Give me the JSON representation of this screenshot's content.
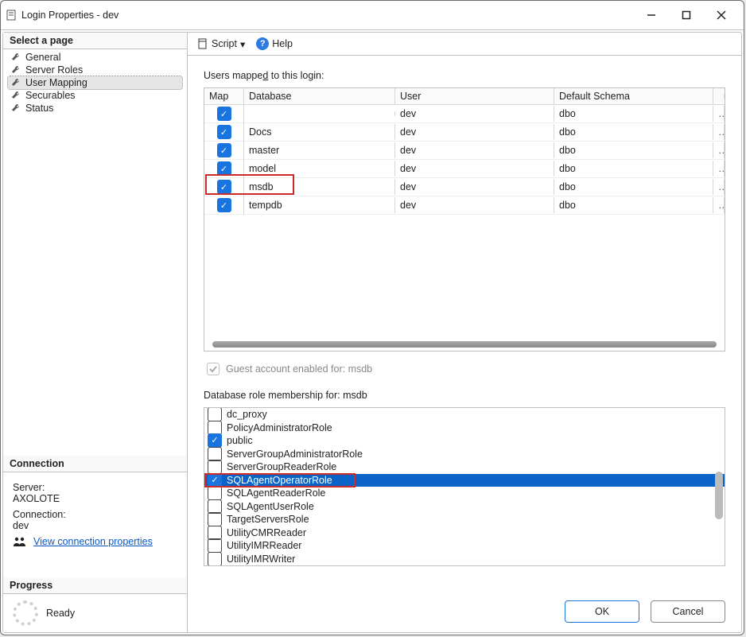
{
  "window": {
    "title": "Login Properties - dev"
  },
  "nav": {
    "heading": "Select a page",
    "items": [
      {
        "label": "General"
      },
      {
        "label": "Server Roles"
      },
      {
        "label": "User Mapping",
        "selected": true
      },
      {
        "label": "Securables"
      },
      {
        "label": "Status"
      }
    ]
  },
  "connection": {
    "heading": "Connection",
    "server_label": "Server:",
    "server_value": "AXOLOTE",
    "connection_label": "Connection:",
    "connection_value": "dev",
    "view_props_link": "View connection properties"
  },
  "progress": {
    "heading": "Progress",
    "status": "Ready"
  },
  "toolbar": {
    "script_label": "Script",
    "help_label": "Help"
  },
  "users_mapped": {
    "title_prefix": "Users mappe",
    "title_accel": "d",
    "title_suffix": " to this login:",
    "columns": {
      "map": "Map",
      "database": "Database",
      "user": "User",
      "schema": "Default Schema"
    },
    "rows": [
      {
        "checked": true,
        "database": "(redacted)",
        "redacted": true,
        "user": "dev",
        "schema": "dbo"
      },
      {
        "checked": true,
        "database": "Docs",
        "user": "dev",
        "schema": "dbo"
      },
      {
        "checked": true,
        "database": "master",
        "user": "dev",
        "schema": "dbo"
      },
      {
        "checked": true,
        "database": "model",
        "user": "dev",
        "schema": "dbo"
      },
      {
        "checked": true,
        "database": "msdb",
        "user": "dev",
        "schema": "dbo",
        "highlighted": true
      },
      {
        "checked": true,
        "database": "tempdb",
        "user": "dev",
        "schema": "dbo"
      }
    ]
  },
  "guest_row": {
    "label": "Guest account enabled for: msdb",
    "checked": true,
    "disabled": true
  },
  "roles": {
    "title": "Database role membership for: msdb",
    "items": [
      {
        "label": "dc_proxy",
        "checked": false
      },
      {
        "label": "PolicyAdministratorRole",
        "checked": false
      },
      {
        "label": "public",
        "checked": true
      },
      {
        "label": "ServerGroupAdministratorRole",
        "checked": false
      },
      {
        "label": "ServerGroupReaderRole",
        "checked": false
      },
      {
        "label": "SQLAgentOperatorRole",
        "checked": true,
        "selected": true,
        "highlighted": true
      },
      {
        "label": "SQLAgentReaderRole",
        "checked": false
      },
      {
        "label": "SQLAgentUserRole",
        "checked": false
      },
      {
        "label": "TargetServersRole",
        "checked": false
      },
      {
        "label": "UtilityCMRReader",
        "checked": false
      },
      {
        "label": "UtilityIMRReader",
        "checked": false
      },
      {
        "label": "UtilityIMRWriter",
        "checked": false
      }
    ]
  },
  "buttons": {
    "ok": "OK",
    "cancel": "Cancel"
  }
}
